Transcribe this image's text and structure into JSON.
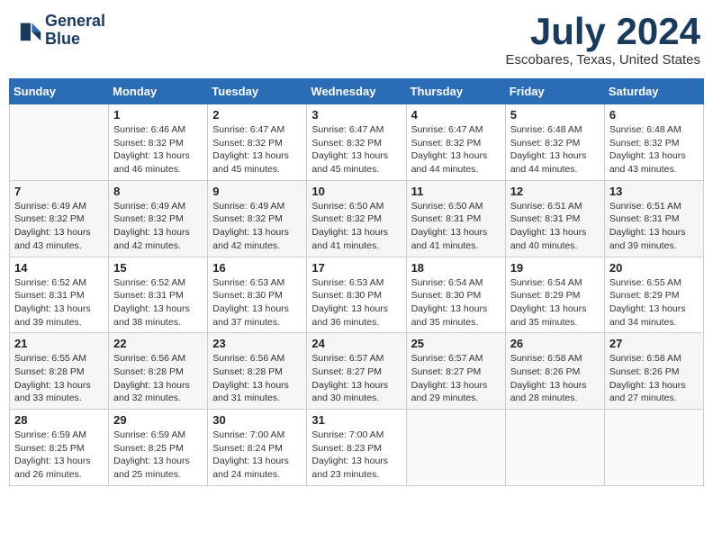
{
  "header": {
    "logo_line1": "General",
    "logo_line2": "Blue",
    "month_title": "July 2024",
    "location": "Escobares, Texas, United States"
  },
  "weekdays": [
    "Sunday",
    "Monday",
    "Tuesday",
    "Wednesday",
    "Thursday",
    "Friday",
    "Saturday"
  ],
  "weeks": [
    [
      {
        "day": "",
        "sunrise": "",
        "sunset": "",
        "daylight": ""
      },
      {
        "day": "1",
        "sunrise": "Sunrise: 6:46 AM",
        "sunset": "Sunset: 8:32 PM",
        "daylight": "Daylight: 13 hours and 46 minutes."
      },
      {
        "day": "2",
        "sunrise": "Sunrise: 6:47 AM",
        "sunset": "Sunset: 8:32 PM",
        "daylight": "Daylight: 13 hours and 45 minutes."
      },
      {
        "day": "3",
        "sunrise": "Sunrise: 6:47 AM",
        "sunset": "Sunset: 8:32 PM",
        "daylight": "Daylight: 13 hours and 45 minutes."
      },
      {
        "day": "4",
        "sunrise": "Sunrise: 6:47 AM",
        "sunset": "Sunset: 8:32 PM",
        "daylight": "Daylight: 13 hours and 44 minutes."
      },
      {
        "day": "5",
        "sunrise": "Sunrise: 6:48 AM",
        "sunset": "Sunset: 8:32 PM",
        "daylight": "Daylight: 13 hours and 44 minutes."
      },
      {
        "day": "6",
        "sunrise": "Sunrise: 6:48 AM",
        "sunset": "Sunset: 8:32 PM",
        "daylight": "Daylight: 13 hours and 43 minutes."
      }
    ],
    [
      {
        "day": "7",
        "sunrise": "Sunrise: 6:49 AM",
        "sunset": "Sunset: 8:32 PM",
        "daylight": "Daylight: 13 hours and 43 minutes."
      },
      {
        "day": "8",
        "sunrise": "Sunrise: 6:49 AM",
        "sunset": "Sunset: 8:32 PM",
        "daylight": "Daylight: 13 hours and 42 minutes."
      },
      {
        "day": "9",
        "sunrise": "Sunrise: 6:49 AM",
        "sunset": "Sunset: 8:32 PM",
        "daylight": "Daylight: 13 hours and 42 minutes."
      },
      {
        "day": "10",
        "sunrise": "Sunrise: 6:50 AM",
        "sunset": "Sunset: 8:32 PM",
        "daylight": "Daylight: 13 hours and 41 minutes."
      },
      {
        "day": "11",
        "sunrise": "Sunrise: 6:50 AM",
        "sunset": "Sunset: 8:31 PM",
        "daylight": "Daylight: 13 hours and 41 minutes."
      },
      {
        "day": "12",
        "sunrise": "Sunrise: 6:51 AM",
        "sunset": "Sunset: 8:31 PM",
        "daylight": "Daylight: 13 hours and 40 minutes."
      },
      {
        "day": "13",
        "sunrise": "Sunrise: 6:51 AM",
        "sunset": "Sunset: 8:31 PM",
        "daylight": "Daylight: 13 hours and 39 minutes."
      }
    ],
    [
      {
        "day": "14",
        "sunrise": "Sunrise: 6:52 AM",
        "sunset": "Sunset: 8:31 PM",
        "daylight": "Daylight: 13 hours and 39 minutes."
      },
      {
        "day": "15",
        "sunrise": "Sunrise: 6:52 AM",
        "sunset": "Sunset: 8:31 PM",
        "daylight": "Daylight: 13 hours and 38 minutes."
      },
      {
        "day": "16",
        "sunrise": "Sunrise: 6:53 AM",
        "sunset": "Sunset: 8:30 PM",
        "daylight": "Daylight: 13 hours and 37 minutes."
      },
      {
        "day": "17",
        "sunrise": "Sunrise: 6:53 AM",
        "sunset": "Sunset: 8:30 PM",
        "daylight": "Daylight: 13 hours and 36 minutes."
      },
      {
        "day": "18",
        "sunrise": "Sunrise: 6:54 AM",
        "sunset": "Sunset: 8:30 PM",
        "daylight": "Daylight: 13 hours and 35 minutes."
      },
      {
        "day": "19",
        "sunrise": "Sunrise: 6:54 AM",
        "sunset": "Sunset: 8:29 PM",
        "daylight": "Daylight: 13 hours and 35 minutes."
      },
      {
        "day": "20",
        "sunrise": "Sunrise: 6:55 AM",
        "sunset": "Sunset: 8:29 PM",
        "daylight": "Daylight: 13 hours and 34 minutes."
      }
    ],
    [
      {
        "day": "21",
        "sunrise": "Sunrise: 6:55 AM",
        "sunset": "Sunset: 8:28 PM",
        "daylight": "Daylight: 13 hours and 33 minutes."
      },
      {
        "day": "22",
        "sunrise": "Sunrise: 6:56 AM",
        "sunset": "Sunset: 8:28 PM",
        "daylight": "Daylight: 13 hours and 32 minutes."
      },
      {
        "day": "23",
        "sunrise": "Sunrise: 6:56 AM",
        "sunset": "Sunset: 8:28 PM",
        "daylight": "Daylight: 13 hours and 31 minutes."
      },
      {
        "day": "24",
        "sunrise": "Sunrise: 6:57 AM",
        "sunset": "Sunset: 8:27 PM",
        "daylight": "Daylight: 13 hours and 30 minutes."
      },
      {
        "day": "25",
        "sunrise": "Sunrise: 6:57 AM",
        "sunset": "Sunset: 8:27 PM",
        "daylight": "Daylight: 13 hours and 29 minutes."
      },
      {
        "day": "26",
        "sunrise": "Sunrise: 6:58 AM",
        "sunset": "Sunset: 8:26 PM",
        "daylight": "Daylight: 13 hours and 28 minutes."
      },
      {
        "day": "27",
        "sunrise": "Sunrise: 6:58 AM",
        "sunset": "Sunset: 8:26 PM",
        "daylight": "Daylight: 13 hours and 27 minutes."
      }
    ],
    [
      {
        "day": "28",
        "sunrise": "Sunrise: 6:59 AM",
        "sunset": "Sunset: 8:25 PM",
        "daylight": "Daylight: 13 hours and 26 minutes."
      },
      {
        "day": "29",
        "sunrise": "Sunrise: 6:59 AM",
        "sunset": "Sunset: 8:25 PM",
        "daylight": "Daylight: 13 hours and 25 minutes."
      },
      {
        "day": "30",
        "sunrise": "Sunrise: 7:00 AM",
        "sunset": "Sunset: 8:24 PM",
        "daylight": "Daylight: 13 hours and 24 minutes."
      },
      {
        "day": "31",
        "sunrise": "Sunrise: 7:00 AM",
        "sunset": "Sunset: 8:23 PM",
        "daylight": "Daylight: 13 hours and 23 minutes."
      },
      {
        "day": "",
        "sunrise": "",
        "sunset": "",
        "daylight": ""
      },
      {
        "day": "",
        "sunrise": "",
        "sunset": "",
        "daylight": ""
      },
      {
        "day": "",
        "sunrise": "",
        "sunset": "",
        "daylight": ""
      }
    ]
  ]
}
